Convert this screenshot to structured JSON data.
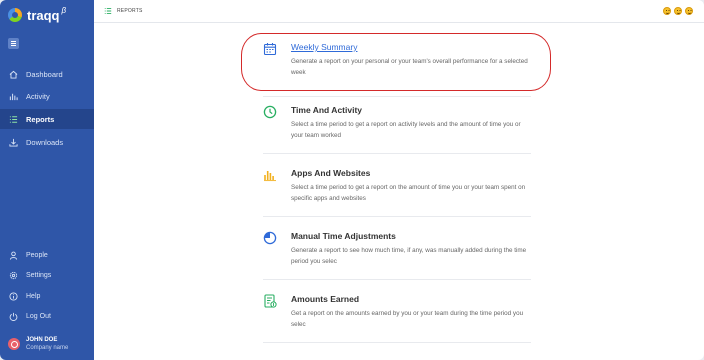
{
  "app": {
    "name": "traqq",
    "beta_mark": "β"
  },
  "sidebar": {
    "items": [
      {
        "label": "Dashboard",
        "icon": "home-icon"
      },
      {
        "label": "Activity",
        "icon": "bar-chart-icon"
      },
      {
        "label": "Reports",
        "icon": "list-icon",
        "active": true
      },
      {
        "label": "Downloads",
        "icon": "download-icon"
      }
    ],
    "bottom_items": [
      {
        "label": "People",
        "icon": "person-icon"
      },
      {
        "label": "Settings",
        "icon": "gear-icon"
      },
      {
        "label": "Help",
        "icon": "info-icon"
      },
      {
        "label": "Log Out",
        "icon": "power-icon"
      }
    ],
    "user": {
      "name": "JOHN DOE",
      "company": "Company name"
    }
  },
  "header": {
    "breadcrumb": "REPORTS"
  },
  "reports": [
    {
      "title": "Weekly Summary",
      "description": "Generate a report on your personal or your team's overall performance for a selected week",
      "icon": "calendar-icon",
      "color": "#2f6ad8"
    },
    {
      "title": "Time And Activity",
      "description": "Select a time period to get a report on activity levels and the amount of time you or your team worked",
      "icon": "clock-icon",
      "color": "#27ae60"
    },
    {
      "title": "Apps And Websites",
      "description": "Select a time period to get a report on the amount of time you or your team spent on specific apps and websites",
      "icon": "bar-chart-icon",
      "color": "#f2b01e"
    },
    {
      "title": "Manual Time Adjustments",
      "description": "Generate a report to see how much time, if any, was manually added during the time period you selec",
      "icon": "pie-chart-icon",
      "color": "#2f6ad8"
    },
    {
      "title": "Amounts Earned",
      "description": "Get a report on the amounts earned by you or your team during the time period you selec",
      "icon": "invoice-icon",
      "color": "#27ae60"
    }
  ],
  "colors": {
    "sidebar_bg": "#2f56a8",
    "active_item_bg": "#24458c",
    "highlight": "#d42a2a",
    "link": "#2f6ad8"
  }
}
